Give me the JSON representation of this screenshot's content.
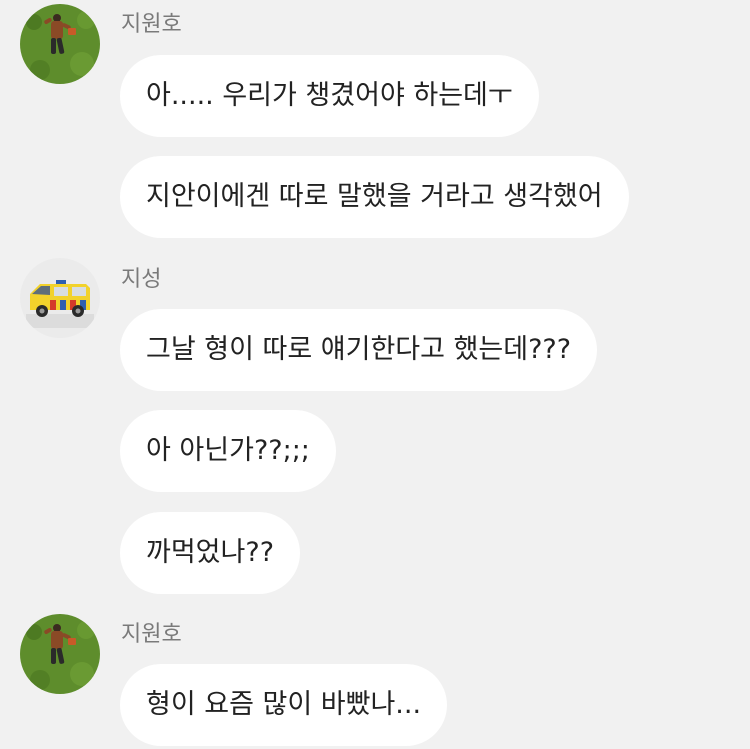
{
  "conversation": [
    {
      "sender": "지원호",
      "avatar_icon": "person-on-grass-avatar-icon",
      "messages": [
        "아..... 우리가 챙겼어야 하는데ㅜ",
        "지안이에겐 따로 말했을 거라고 생각했어"
      ]
    },
    {
      "sender": "지성",
      "avatar_icon": "yellow-ambulance-avatar-icon",
      "messages": [
        "그날 형이 따로 얘기한다고 했는데???",
        "아 아닌가??;;;",
        "까먹었나??"
      ]
    },
    {
      "sender": "지원호",
      "avatar_icon": "person-on-grass-avatar-icon",
      "messages": [
        "형이 요즘 많이 바빴나..."
      ]
    }
  ],
  "colors": {
    "background": "#f1f1f1",
    "bubble": "#ffffff",
    "text": "#222222",
    "sender_name": "#7a7a7a",
    "grass": "#5a8a2a",
    "ambulance": "#f2d22b"
  }
}
